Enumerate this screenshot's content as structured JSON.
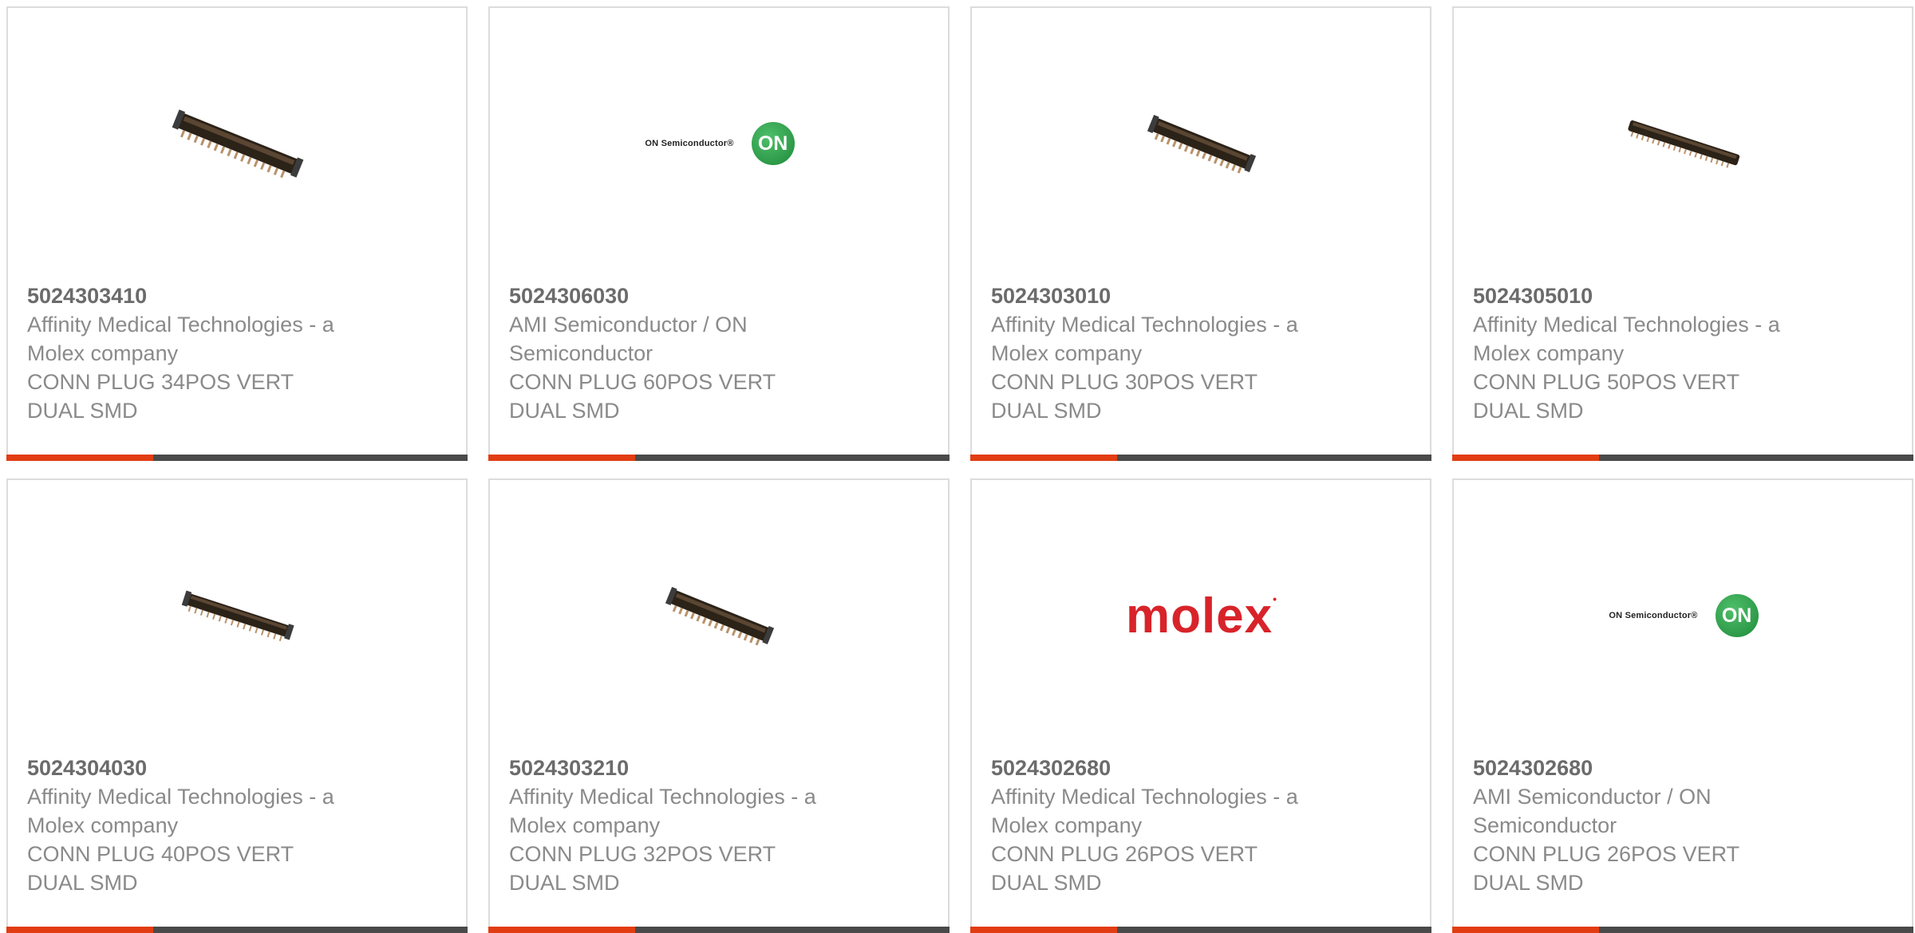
{
  "colors": {
    "accent": "#e23d12",
    "bar": "#4a4a4a",
    "part_number": "#6b6b6b",
    "text": "#8a8a8a",
    "molex_red": "#d8232a",
    "on_green": "#2a9b46"
  },
  "products": [
    {
      "part_number": "5024303410",
      "manufacturer": [
        "Affinity Medical Technologies - a",
        "Molex company"
      ],
      "description": [
        "CONN PLUG 34POS VERT",
        "DUAL SMD"
      ],
      "image": "connector-photo"
    },
    {
      "part_number": "5024306030",
      "manufacturer": [
        "AMI Semiconductor / ON",
        "Semiconductor"
      ],
      "description": [
        "CONN PLUG 60POS VERT",
        "DUAL SMD"
      ],
      "image": "on-semiconductor-logo",
      "logo_text": "ON Semiconductor®",
      "logo_mark": "ON"
    },
    {
      "part_number": "5024303010",
      "manufacturer": [
        "Affinity Medical Technologies - a",
        "Molex company"
      ],
      "description": [
        "CONN PLUG 30POS VERT",
        "DUAL SMD"
      ],
      "image": "connector-photo"
    },
    {
      "part_number": "5024305010",
      "manufacturer": [
        "Affinity Medical Technologies - a",
        "Molex company"
      ],
      "description": [
        "CONN PLUG 50POS VERT",
        "DUAL SMD"
      ],
      "image": "connector-photo"
    },
    {
      "part_number": "5024304030",
      "manufacturer": [
        "Affinity Medical Technologies - a",
        "Molex company"
      ],
      "description": [
        "CONN PLUG 40POS VERT",
        "DUAL SMD"
      ],
      "image": "connector-photo"
    },
    {
      "part_number": "5024303210",
      "manufacturer": [
        "Affinity Medical Technologies - a",
        "Molex company"
      ],
      "description": [
        "CONN PLUG 32POS VERT",
        "DUAL SMD"
      ],
      "image": "connector-photo"
    },
    {
      "part_number": "5024302680",
      "manufacturer": [
        "Affinity Medical Technologies - a",
        "Molex company"
      ],
      "description": [
        "CONN PLUG 26POS VERT",
        "DUAL SMD"
      ],
      "image": "molex-logo",
      "logo_text": "molex"
    },
    {
      "part_number": "5024302680",
      "manufacturer": [
        "AMI Semiconductor / ON",
        "Semiconductor"
      ],
      "description": [
        "CONN PLUG 26POS VERT",
        "DUAL SMD"
      ],
      "image": "on-semiconductor-logo",
      "logo_text": "ON Semiconductor®",
      "logo_mark": "ON"
    }
  ]
}
